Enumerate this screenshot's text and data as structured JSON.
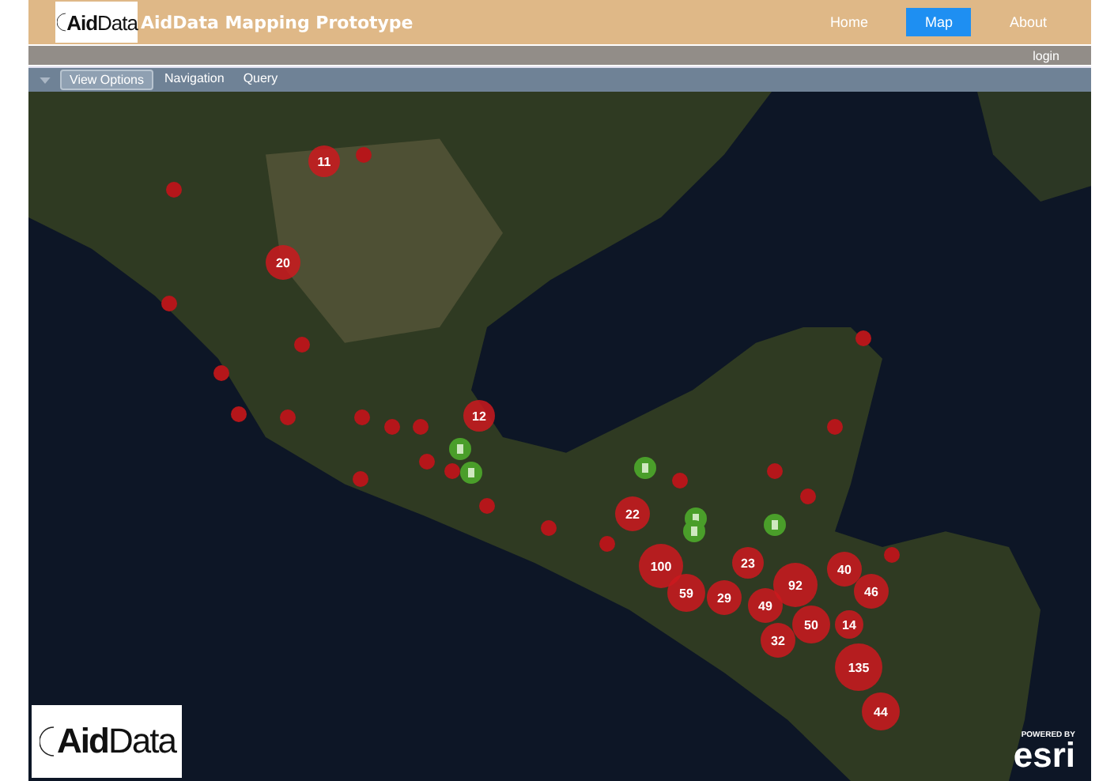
{
  "header": {
    "logo": "**Aid**Data",
    "title": "AidData Mapping Prototype",
    "nav": [
      {
        "label": "Home",
        "selected": false
      },
      {
        "label": "Map",
        "selected": true
      },
      {
        "label": "About",
        "selected": false
      }
    ]
  },
  "account_bar": {
    "link": "login"
  },
  "toolbar": {
    "tabs": [
      {
        "label": "View Options",
        "selected": true
      },
      {
        "label": "Navigation",
        "selected": false
      },
      {
        "label": "Query",
        "selected": false
      }
    ]
  },
  "map": {
    "clusters": [
      {
        "count": "11"
      },
      {
        "count": "20"
      },
      {
        "count": "12"
      },
      {
        "count": "22"
      },
      {
        "count": "100"
      },
      {
        "count": "59"
      },
      {
        "count": "29"
      },
      {
        "count": "23"
      },
      {
        "count": "92"
      },
      {
        "count": "49"
      },
      {
        "count": "50"
      },
      {
        "count": "32"
      },
      {
        "count": "40"
      },
      {
        "count": "46"
      },
      {
        "count": "14"
      },
      {
        "count": "135"
      },
      {
        "count": "44"
      }
    ],
    "logo": "**Aid**Data",
    "attribution": {
      "prefix": "POWERED BY",
      "brand": "esri"
    }
  }
}
